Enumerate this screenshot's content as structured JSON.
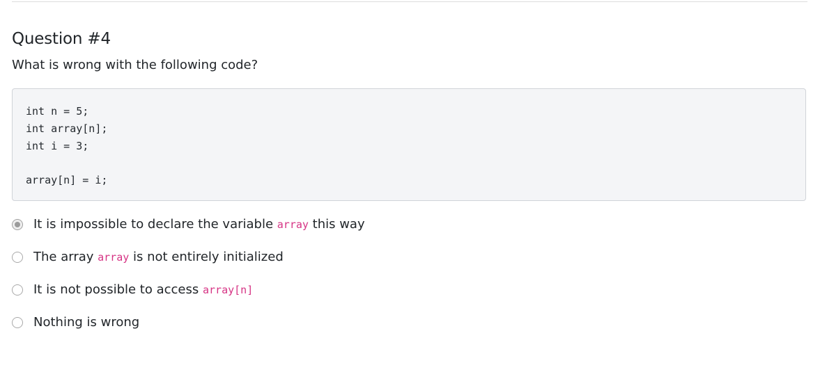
{
  "question": {
    "title": "Question #4",
    "prompt": "What is wrong with the following code?"
  },
  "code": {
    "lines": [
      "int n = 5;",
      "int array[n];",
      "int i = 3;",
      "",
      "array[n] = i;"
    ]
  },
  "options": [
    {
      "selected": true,
      "text_before": "It is impossible to declare the variable ",
      "code": "array",
      "text_after": " this way"
    },
    {
      "selected": false,
      "text_before": "The array ",
      "code": "array",
      "text_after": " is not entirely initialized"
    },
    {
      "selected": false,
      "text_before": "It is not possible to access ",
      "code": "array[n]",
      "text_after": ""
    },
    {
      "selected": false,
      "text_before": "Nothing is wrong",
      "code": "",
      "text_after": ""
    }
  ],
  "colors": {
    "inline_code": "#d63384",
    "code_background": "#f4f5f7",
    "code_border": "#d0d3d8"
  }
}
